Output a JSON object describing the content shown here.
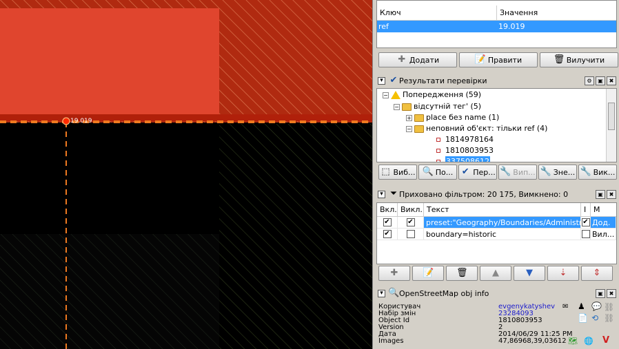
{
  "map": {
    "node_label": "19.019",
    "colors": {
      "red_fill": "#e0452e",
      "dark_red": "#b02a10",
      "hatch": "#c86a45",
      "dash": "#f07a20",
      "bg": "#000000"
    }
  },
  "tags": {
    "col_key": "Ключ",
    "col_value": "Значення",
    "rows": [
      {
        "key": "ref",
        "value": "19.019"
      }
    ],
    "buttons": {
      "add": "Додати",
      "edit": "Правити",
      "delete": "Вилучити"
    }
  },
  "validation": {
    "title": "Результати перевірки",
    "tree": {
      "root": "Попередження (59)",
      "group": "відсутній тег' (5)",
      "item1": "place без name (1)",
      "item2": "неповний об'єкт: тільки ref (4)",
      "leaf1": "1814978164",
      "leaf2": "1810803953",
      "leaf3": "337508612"
    },
    "buttons": {
      "select": "Виб...",
      "zoom": "По...",
      "check": "Пер...",
      "fix": "Вип...",
      "ignore": "Зне...",
      "more": "Вик..."
    }
  },
  "filter": {
    "title": "Приховано фільтром: 20 175, Вимкнено: 0",
    "cols": {
      "enabled": "Вкл.",
      "hide": "Викл.",
      "text": "Текст",
      "inverted": "I",
      "mode": "M"
    },
    "rows": [
      {
        "text": "preset:\"Geography/Boundaries/Administrati...",
        "mode": "Дод."
      },
      {
        "text": "boundary=historic",
        "mode": "Вил..."
      }
    ]
  },
  "info": {
    "title": "OpenStreetMap obj info",
    "user_label": "Користувач",
    "user_value": "evgenykatyshev",
    "changeset_label": "Набір змін",
    "changeset_value": "23284093",
    "objid_label": "Object Id",
    "objid_value": "1810803953",
    "version_label": "Version",
    "version_value": "2",
    "date_label": "Дата",
    "date_value": "2014/06/29 11:25 PM",
    "images_label": "Images",
    "images_value": "47,86968,39,03612"
  }
}
